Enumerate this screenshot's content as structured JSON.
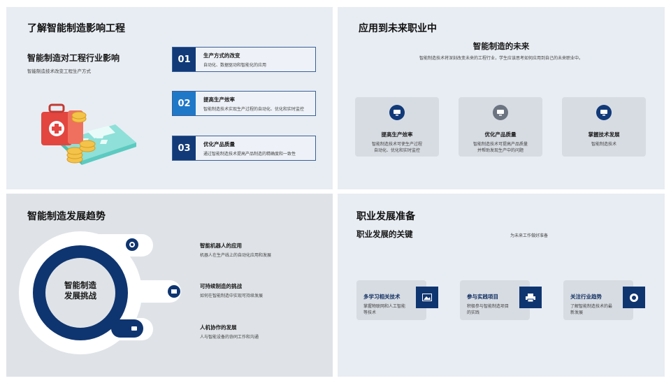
{
  "slide1": {
    "title": "了解智能制造影响工程",
    "subtitle": "智能制造对工程行业影响",
    "desc": "智能制造技术改变工程生产方式",
    "items": [
      {
        "num": "01",
        "title": "生产方式的改变",
        "desc": "自动化、数据驱动和智能化的应用",
        "color": "#123a78"
      },
      {
        "num": "02",
        "title": "提高生产效率",
        "desc": "智能制造技术实现生产过程的自动化、优化和实时监控",
        "color": "#1f78c8"
      },
      {
        "num": "03",
        "title": "优化产品质量",
        "desc": "通过智能制造技术提高产品制造的精确度和一致性",
        "color": "#123a78"
      }
    ]
  },
  "slide2": {
    "title": "应用到未来职业中",
    "center_title": "智能制造的未来",
    "center_desc": "智能制造技术将深刻改变未来的工程行业，学生应该思考如何应用到自己的未来职业中。",
    "cards": [
      {
        "title": "提高生产效率",
        "desc_line1": "智能制造技术可使生产过程",
        "desc_line2": "自动化、优化和实时监控",
        "icon": "monitor-icon",
        "icon_color": "#123a78"
      },
      {
        "title": "优化产品质量",
        "desc_line1": "智能制造技术可提高产品质量",
        "desc_line2": "并帮助发现生产中的问题",
        "icon": "monitor-icon",
        "icon_color": "#6b7480"
      },
      {
        "title": "掌握技术发展",
        "desc_line1": "智能制造技术",
        "desc_line2": "",
        "icon": "monitor-icon",
        "icon_color": "#123a78"
      }
    ]
  },
  "slide3": {
    "title": "智能制造发展趋势",
    "center_label_line1": "智能制造",
    "center_label_line2": "发展挑战",
    "trends": [
      {
        "title": "智能机器人的应用",
        "desc": "机器人在生产线上的自动化应用和发展"
      },
      {
        "title": "可持续制造的挑战",
        "desc": "如何在智能制造中实现可持续发展"
      },
      {
        "title": "人机协作的发展",
        "desc": "人与智能设备的协同工作和沟通"
      }
    ]
  },
  "slide4": {
    "title": "职业发展准备",
    "sub": "职业发展的关键",
    "note": "为未来工作做好准备",
    "cards": [
      {
        "title": "多学习相关技术",
        "desc": "掌握物联网和人工智能等技术",
        "icon": "image-icon"
      },
      {
        "title": "参与实践项目",
        "desc": "积极参与智能制造项目的实践",
        "icon": "printer-icon"
      },
      {
        "title": "关注行业趋势",
        "desc": "了解智能制造技术的最新发展",
        "icon": "target-icon"
      }
    ]
  }
}
